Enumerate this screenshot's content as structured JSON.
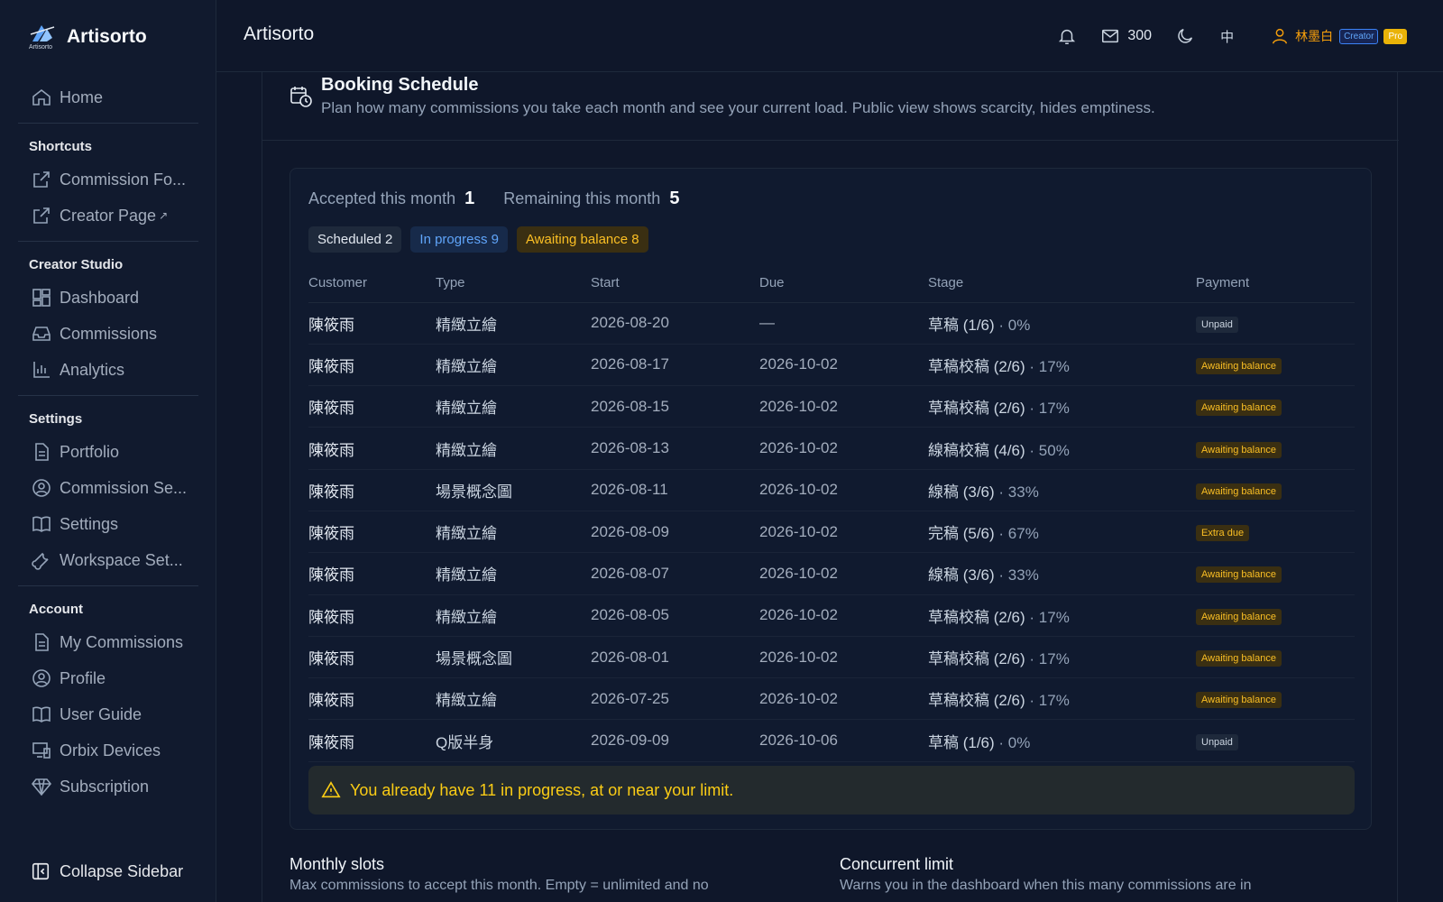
{
  "brand": {
    "name": "Artisorto",
    "logo_text": "Artisorto"
  },
  "topbar": {
    "title": "Artisorto",
    "mail_count": "300",
    "lang": "中",
    "user_name": "林墨白",
    "badge_creator": "Creator",
    "badge_pro": "Pro"
  },
  "sidebar": {
    "home": "Home",
    "shortcuts_head": "Shortcuts",
    "commission_form": "Commission Fo...",
    "creator_page": "Creator Page",
    "ext_mark": "↗",
    "studio_head": "Creator Studio",
    "dashboard": "Dashboard",
    "commissions": "Commissions",
    "analytics": "Analytics",
    "settings_head": "Settings",
    "portfolio": "Portfolio",
    "commission_settings": "Commission Se...",
    "settings": "Settings",
    "workspace_settings": "Workspace Set...",
    "account_head": "Account",
    "my_commissions": "My Commissions",
    "profile": "Profile",
    "user_guide": "User Guide",
    "orbix_devices": "Orbix Devices",
    "subscription": "Subscription",
    "collapse": "Collapse Sidebar"
  },
  "page": {
    "title": "Booking Schedule",
    "subtitle": "Plan how many commissions you take each month and see your current load. Public view shows scarcity, hides emptiness."
  },
  "stats": {
    "accepted_label": "Accepted this month",
    "accepted_value": "1",
    "remaining_label": "Remaining this month",
    "remaining_value": "5"
  },
  "chips": {
    "scheduled": "Scheduled 2",
    "in_progress": "In progress 9",
    "awaiting": "Awaiting balance 8"
  },
  "table": {
    "headers": {
      "customer": "Customer",
      "type": "Type",
      "start": "Start",
      "due": "Due",
      "stage": "Stage",
      "payment": "Payment"
    },
    "rows": [
      {
        "customer": "陳筱雨",
        "type": "精緻立繪",
        "start": "2026-08-20",
        "due": "—",
        "stage": "草稿 (1/6)",
        "pct": "· 0%",
        "payment": "Unpaid",
        "pay_kind": "unpaid"
      },
      {
        "customer": "陳筱雨",
        "type": "精緻立繪",
        "start": "2026-08-17",
        "due": "2026-10-02",
        "stage": "草稿校稿 (2/6)",
        "pct": "· 17%",
        "payment": "Awaiting balance",
        "pay_kind": "await"
      },
      {
        "customer": "陳筱雨",
        "type": "精緻立繪",
        "start": "2026-08-15",
        "due": "2026-10-02",
        "stage": "草稿校稿 (2/6)",
        "pct": "· 17%",
        "payment": "Awaiting balance",
        "pay_kind": "await"
      },
      {
        "customer": "陳筱雨",
        "type": "精緻立繪",
        "start": "2026-08-13",
        "due": "2026-10-02",
        "stage": "線稿校稿 (4/6)",
        "pct": "· 50%",
        "payment": "Awaiting balance",
        "pay_kind": "await"
      },
      {
        "customer": "陳筱雨",
        "type": "場景概念圖",
        "start": "2026-08-11",
        "due": "2026-10-02",
        "stage": "線稿 (3/6)",
        "pct": "· 33%",
        "payment": "Awaiting balance",
        "pay_kind": "await"
      },
      {
        "customer": "陳筱雨",
        "type": "精緻立繪",
        "start": "2026-08-09",
        "due": "2026-10-02",
        "stage": "完稿 (5/6)",
        "pct": "· 67%",
        "payment": "Extra due",
        "pay_kind": "await"
      },
      {
        "customer": "陳筱雨",
        "type": "精緻立繪",
        "start": "2026-08-07",
        "due": "2026-10-02",
        "stage": "線稿 (3/6)",
        "pct": "· 33%",
        "payment": "Awaiting balance",
        "pay_kind": "await"
      },
      {
        "customer": "陳筱雨",
        "type": "精緻立繪",
        "start": "2026-08-05",
        "due": "2026-10-02",
        "stage": "草稿校稿 (2/6)",
        "pct": "· 17%",
        "payment": "Awaiting balance",
        "pay_kind": "await"
      },
      {
        "customer": "陳筱雨",
        "type": "場景概念圖",
        "start": "2026-08-01",
        "due": "2026-10-02",
        "stage": "草稿校稿 (2/6)",
        "pct": "· 17%",
        "payment": "Awaiting balance",
        "pay_kind": "await"
      },
      {
        "customer": "陳筱雨",
        "type": "精緻立繪",
        "start": "2026-07-25",
        "due": "2026-10-02",
        "stage": "草稿校稿 (2/6)",
        "pct": "· 17%",
        "payment": "Awaiting balance",
        "pay_kind": "await"
      },
      {
        "customer": "陳筱雨",
        "type": "Q版半身",
        "start": "2026-09-09",
        "due": "2026-10-06",
        "stage": "草稿 (1/6)",
        "pct": "· 0%",
        "payment": "Unpaid",
        "pay_kind": "unpaid"
      }
    ]
  },
  "warning": "You already have 11 in progress, at or near your limit.",
  "monthly": {
    "title": "Monthly slots",
    "desc": "Max commissions to accept this month. Empty = unlimited and no"
  },
  "concurrent": {
    "title": "Concurrent limit",
    "desc": "Warns you in the dashboard when this many commissions are in"
  }
}
